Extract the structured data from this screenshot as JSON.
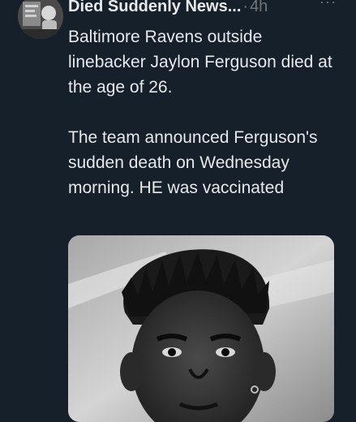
{
  "tweet": {
    "author": "Died Suddenly News...",
    "separator": "·",
    "time": "4h",
    "more_label": "···",
    "paragraphs": [
      "Baltimore Ravens outside linebacker Jaylon Ferguson died at the age of 26.",
      "The team announced Ferguson's sudden death on Wednesday morning. HE was vaccinated"
    ],
    "avatar_icon": "avatar-photo",
    "media_icon": "portrait-photo"
  },
  "colors": {
    "background": "#15202b",
    "text": "#e7e9ea",
    "muted": "#71767b"
  }
}
